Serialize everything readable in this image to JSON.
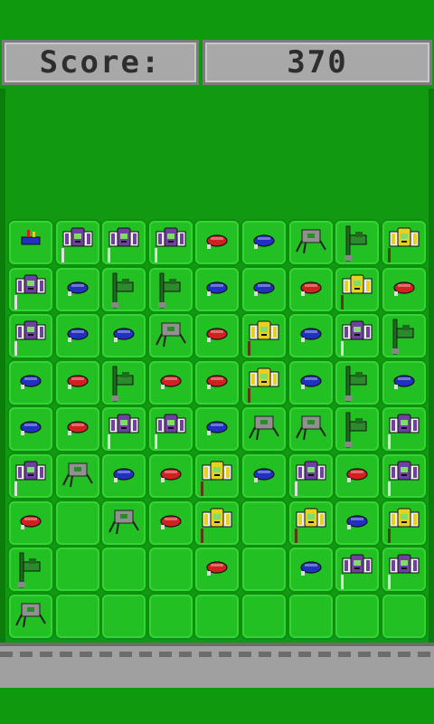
{
  "score": {
    "label": "Score:",
    "value": "370"
  },
  "colors": {
    "yellow": "#e8d020",
    "purple": "#7040a0",
    "gray": "#909090",
    "darkgreen": "#1e6b1e",
    "red": "#d02020",
    "blue": "#2030c0"
  },
  "board": {
    "rows": [
      [
        "small-red-blue-bug",
        "purple-striped-robot",
        "purple-striped-robot",
        "purple-striped-robot",
        "red-beetle",
        "blue-beetle",
        "gray-spider-bot",
        "green-tree-bot",
        "yellow-striped-robot"
      ],
      [
        "purple-striped-robot",
        "blue-beetle",
        "green-tree-bot",
        "green-tree-bot",
        "blue-beetle",
        "blue-beetle",
        "red-beetle",
        "yellow-striped-robot",
        "red-beetle"
      ],
      [
        "purple-striped-robot",
        "blue-beetle",
        "blue-beetle",
        "gray-spider-bot",
        "red-beetle",
        "yellow-striped-robot",
        "blue-beetle",
        "purple-striped-robot",
        "green-tree-bot"
      ],
      [
        "blue-beetle",
        "red-beetle",
        "green-tree-bot",
        "red-beetle",
        "red-beetle",
        "yellow-striped-robot",
        "blue-beetle",
        "green-tree-bot",
        "blue-beetle"
      ],
      [
        "blue-beetle",
        "red-beetle",
        "purple-striped-robot",
        "purple-striped-robot",
        "blue-beetle",
        "gray-spider-bot",
        "gray-spider-bot",
        "green-tree-bot",
        "purple-striped-robot"
      ],
      [
        "purple-striped-robot",
        "gray-spider-bot",
        "blue-beetle",
        "red-beetle",
        "yellow-striped-robot",
        "blue-beetle",
        "purple-striped-robot",
        "red-beetle",
        "purple-striped-robot"
      ],
      [
        "red-beetle",
        "",
        "gray-spider-bot",
        "red-beetle",
        "yellow-striped-robot",
        "",
        "yellow-striped-robot",
        "blue-beetle",
        "yellow-striped-robot"
      ],
      [
        "green-tree-bot",
        "",
        "",
        "",
        "red-beetle",
        "",
        "blue-beetle",
        "purple-striped-robot",
        "purple-striped-robot"
      ],
      [
        "gray-spider-bot",
        "",
        "",
        "",
        "",
        "",
        "",
        "",
        ""
      ]
    ]
  }
}
